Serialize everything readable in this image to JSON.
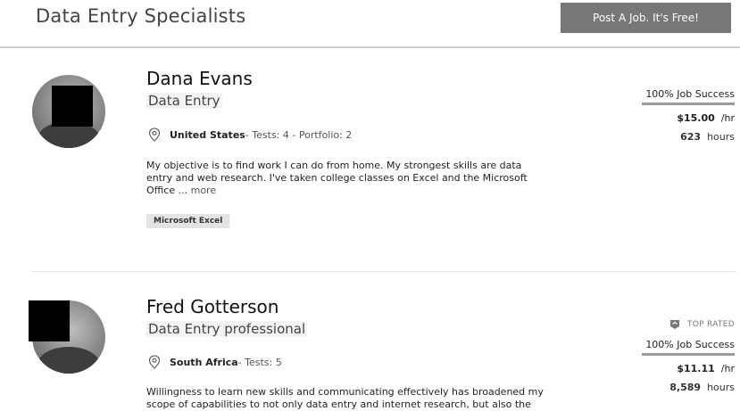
{
  "header": {
    "title": "Data Entry Specialists",
    "post_button": "Post A Job. It's Free!"
  },
  "freelancers": [
    {
      "name": "Dana Evans",
      "title": "Data Entry",
      "country": "United States",
      "meta": " - Tests: 4 - Portfolio: 2",
      "description": "My objective is to find work I can do from home. My strongest skills are data entry and web research. I've taken college classes on Excel and the Microsoft Office ...",
      "more": "more",
      "skills": [
        "Microsoft Excel"
      ],
      "job_success": "100% Job Success",
      "rate": "$15.00",
      "rate_unit": "/hr",
      "hours": "623",
      "hours_label": "hours"
    },
    {
      "name": "Fred Gotterson",
      "title": "Data Entry professional",
      "country": "South Africa",
      "meta": " - Tests: 5",
      "description": "Willingness to learn new skills and communicating effectively has broadened my scope of capabilities to not only data entry and internet research, but also the",
      "badge": "TOP RATED",
      "job_success": "100% Job Success",
      "rate": "$11.11",
      "rate_unit": "/hr",
      "hours": "8,589",
      "hours_label": "hours"
    }
  ]
}
